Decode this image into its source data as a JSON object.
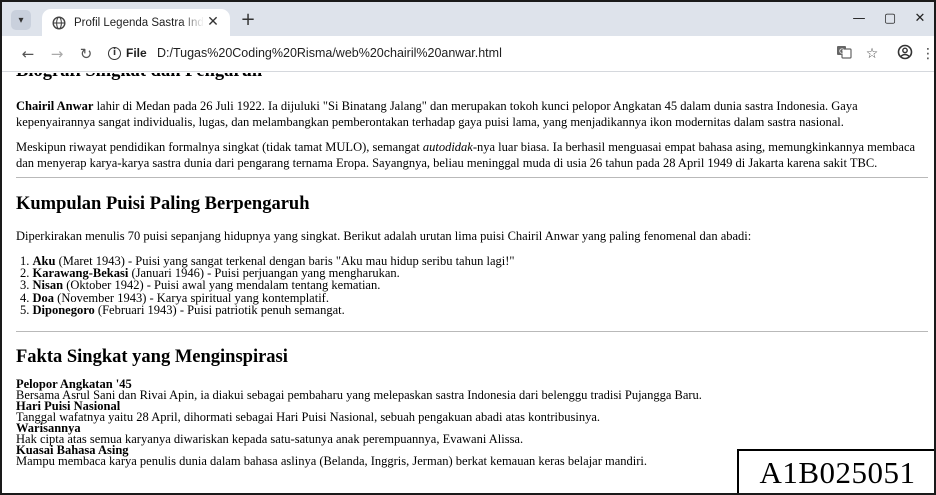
{
  "browser": {
    "tab_title": "Profil Legenda Sastra Indonesia",
    "tab_close": "✕",
    "new_tab": "+",
    "window_controls": {
      "minimize": "—",
      "maximize": "▢",
      "close": "✕"
    },
    "nav": {
      "back": "←",
      "forward": "→",
      "reload": "↻"
    },
    "address": {
      "scheme_label": "File",
      "info_glyph": "i",
      "url": "D:/Tugas%20Coding%20Risma/web%20chairil%20anwar.html"
    },
    "icons": [
      "translate-icon",
      "bookmark-star-icon",
      "profile-icon",
      "menu-kebab-icon"
    ]
  },
  "page": {
    "cut_heading": "Biografi Singkat dan Pengaruh",
    "bio_p1_name": "Chairil Anwar",
    "bio_p1_text": " lahir di Medan pada 26 Juli 1922. Ia dijuluki \"Si Binatang Jalang\" dan merupakan tokoh kunci pelopor Angkatan 45 dalam dunia sastra Indonesia. Gaya kepenyairannya sangat individualis, lugas, dan melambangkan pemberontakan terhadap gaya puisi lama, yang menjadikannya ikon modernitas dalam sastra nasional.",
    "bio_p2_a": "Meskipun riwayat pendidikan formalnya singkat (tidak tamat MULO), semangat ",
    "bio_p2_em": "autodidak",
    "bio_p2_b": "-nya luar biasa. Ia berhasil menguasai empat bahasa asing, memungkinkannya membaca dan menyerap karya-karya sastra dunia dari pengarang ternama Eropa. Sayangnya, beliau meninggal muda di usia 26 tahun pada 28 April 1949 di Jakarta karena sakit TBC.",
    "poems_heading": "Kumpulan Puisi Paling Berpengaruh",
    "poems_intro": "Diperkirakan menulis 70 puisi sepanjang hidupnya yang singkat. Berikut adalah urutan lima puisi Chairil Anwar yang paling fenomenal dan abadi:",
    "poems": [
      {
        "num": "1.",
        "title": "Aku",
        "desc": " (Maret 1943) - Puisi yang sangat terkenal dengan baris \"Aku mau hidup seribu tahun lagi!\""
      },
      {
        "num": "2.",
        "title": "Karawang-Bekasi",
        "desc": " (Januari 1946) - Puisi perjuangan yang mengharukan."
      },
      {
        "num": "3.",
        "title": "Nisan",
        "desc": " (Oktober 1942) - Puisi awal yang mendalam tentang kematian."
      },
      {
        "num": "4.",
        "title": "Doa",
        "desc": " (November 1943) - Karya spiritual yang kontemplatif."
      },
      {
        "num": "5.",
        "title": "Diponegoro",
        "desc": " (Februari 1943) - Puisi patriotik penuh semangat."
      }
    ],
    "facts_heading": "Fakta Singkat yang Menginspirasi",
    "facts": [
      {
        "title": "Pelopor Angkatan '45",
        "desc": "Bersama Asrul Sani dan Rivai Apin, ia diakui sebagai pembaharu yang melepaskan sastra Indonesia dari belenggu tradisi Pujangga Baru."
      },
      {
        "title": "Hari Puisi Nasional",
        "desc": "Tanggal wafatnya yaitu 28 April, dihormati sebagai Hari Puisi Nasional, sebuah pengakuan abadi atas kontribusinya."
      },
      {
        "title": "Warisannya",
        "desc": "Hak cipta atas semua karyanya diwariskan kepada satu-satunya anak perempuannya, Evawani Alissa."
      },
      {
        "title": "Kuasai Bahasa Asing",
        "desc": "Mampu membaca karya penulis dunia dalam bahasa aslinya (Belanda, Inggris, Jerman) berkat kemauan keras belajar mandiri."
      }
    ]
  },
  "overlay": {
    "student_id": "A1B025051"
  },
  "colors": {
    "tab_strip": "#dee3eb",
    "toolbar": "#ffffff",
    "divider": "#b9b9b9",
    "text": "#000000"
  }
}
